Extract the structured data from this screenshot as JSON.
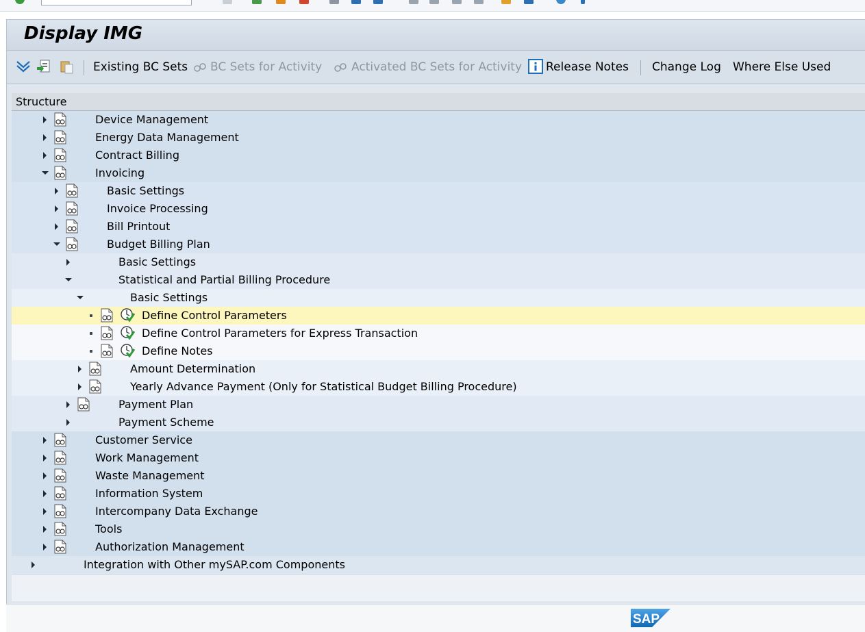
{
  "window_title": "Display IMG",
  "toolbar": {
    "existing_bc_sets": "Existing BC Sets",
    "bc_sets_for_activity": "BC Sets for Activity",
    "activated_bc_sets_for_activity": "Activated BC Sets for Activity",
    "release_notes": "Release Notes",
    "change_log": "Change Log",
    "where_else_used": "Where Else Used"
  },
  "tree": {
    "header": "Structure",
    "rows": [
      {
        "label": "Device Management",
        "level": 2,
        "state": "collapsed",
        "doc": true
      },
      {
        "label": "Energy Data Management",
        "level": 2,
        "state": "collapsed",
        "doc": true
      },
      {
        "label": "Contract Billing",
        "level": 2,
        "state": "collapsed",
        "doc": true
      },
      {
        "label": "Invoicing",
        "level": 2,
        "state": "expanded",
        "doc": true
      },
      {
        "label": "Basic Settings",
        "level": 3,
        "state": "collapsed",
        "doc": true
      },
      {
        "label": "Invoice Processing",
        "level": 3,
        "state": "collapsed",
        "doc": true
      },
      {
        "label": "Bill Printout",
        "level": 3,
        "state": "collapsed",
        "doc": true
      },
      {
        "label": "Budget Billing Plan",
        "level": 3,
        "state": "expanded",
        "doc": true
      },
      {
        "label": "Basic Settings",
        "level": 4,
        "state": "collapsed",
        "doc": false
      },
      {
        "label": "Statistical and Partial Billing Procedure",
        "level": 4,
        "state": "expanded",
        "doc": false
      },
      {
        "label": "Basic Settings",
        "level": 5,
        "state": "expanded",
        "doc": false
      },
      {
        "label": "Define Control Parameters",
        "level": 6,
        "state": "leaf",
        "doc": true,
        "exec": true,
        "selected": true
      },
      {
        "label": "Define Control Parameters for Express Transaction",
        "level": 6,
        "state": "leaf",
        "doc": true,
        "exec": true
      },
      {
        "label": "Define Notes",
        "level": 6,
        "state": "leaf",
        "doc": true,
        "exec": true
      },
      {
        "label": "Amount Determination",
        "level": 5,
        "state": "collapsed",
        "doc": true
      },
      {
        "label": "Yearly Advance Payment (Only for Statistical Budget Billing Procedure)",
        "level": 5,
        "state": "collapsed",
        "doc": true
      },
      {
        "label": "Payment Plan",
        "level": 4,
        "state": "collapsed",
        "doc": true
      },
      {
        "label": "Payment Scheme",
        "level": 4,
        "state": "collapsed",
        "doc": false
      },
      {
        "label": "Customer Service",
        "level": 2,
        "state": "collapsed",
        "doc": true
      },
      {
        "label": "Work Management",
        "level": 2,
        "state": "collapsed",
        "doc": true
      },
      {
        "label": "Waste Management",
        "level": 2,
        "state": "collapsed",
        "doc": true
      },
      {
        "label": "Information System",
        "level": 2,
        "state": "collapsed",
        "doc": true
      },
      {
        "label": "Intercompany Data Exchange",
        "level": 2,
        "state": "collapsed",
        "doc": true
      },
      {
        "label": "Tools",
        "level": 2,
        "state": "collapsed",
        "doc": true
      },
      {
        "label": "Authorization Management",
        "level": 2,
        "state": "collapsed",
        "doc": true
      },
      {
        "label": "Integration with Other mySAP.com Components",
        "level": 1,
        "state": "collapsed",
        "doc": false
      }
    ]
  },
  "colors": {
    "selected_row": "#fdf7bd",
    "level_bg": {
      "1": "#dce6f0",
      "2": "#d2dfec",
      "3": "#d8e4f1",
      "4": "#e1eaf4",
      "5": "#eaf0f7",
      "6": "#f6f8fc"
    }
  },
  "logo": "SAP"
}
